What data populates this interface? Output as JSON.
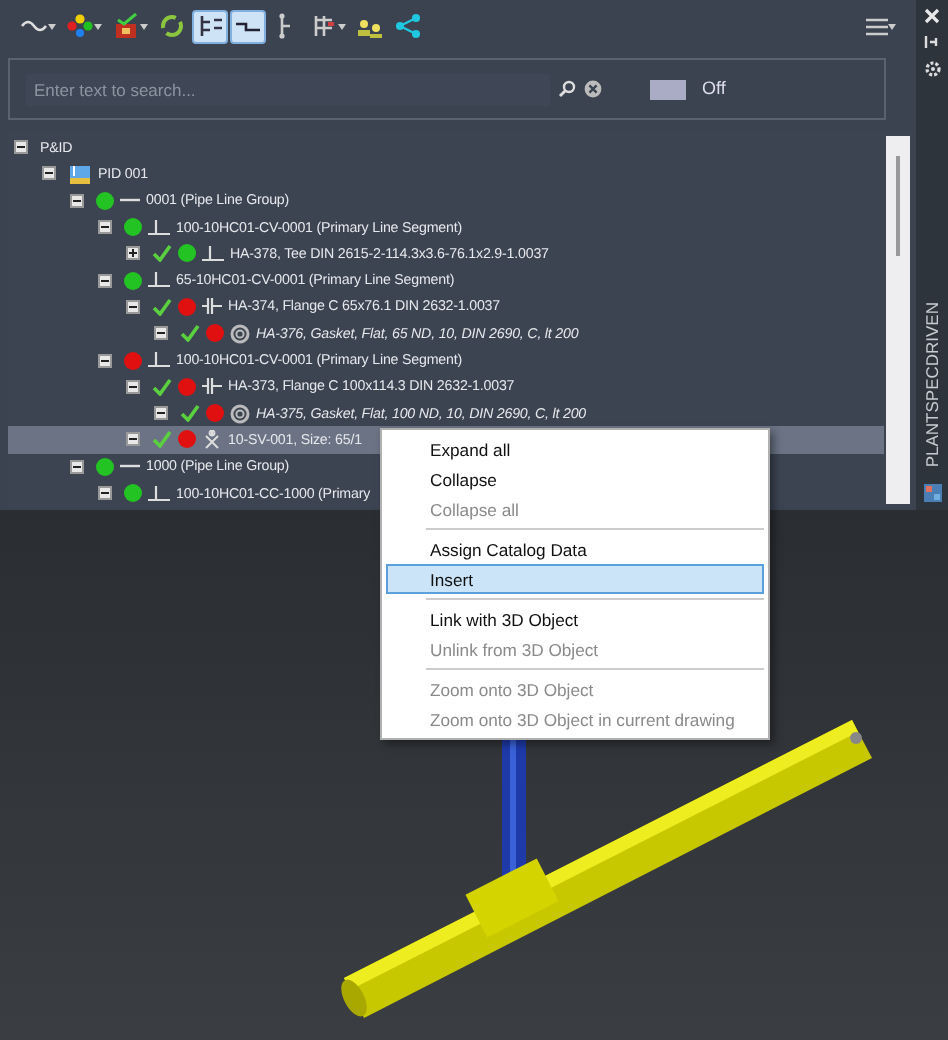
{
  "toolbar": {
    "buttons": [
      {
        "kind": "wave",
        "selected": false,
        "dropdown": true
      },
      {
        "kind": "nodes",
        "selected": false,
        "dropdown": true
      },
      {
        "kind": "lock",
        "selected": false,
        "dropdown": true
      },
      {
        "kind": "refresh",
        "selected": false,
        "dropdown": false
      },
      {
        "kind": "tree",
        "selected": true,
        "dropdown": false
      },
      {
        "kind": "line",
        "selected": true,
        "dropdown": false
      },
      {
        "kind": "branch",
        "selected": false,
        "dropdown": false
      },
      {
        "kind": "table",
        "selected": false,
        "dropdown": true
      },
      {
        "kind": "people",
        "selected": false,
        "dropdown": false
      },
      {
        "kind": "share",
        "selected": false,
        "dropdown": false
      }
    ],
    "menu": {
      "dropdown": true
    }
  },
  "search": {
    "placeholder": "Enter text to search...",
    "toggle": {
      "on": false,
      "label": "Off"
    }
  },
  "tree": [
    {
      "label": "P&ID",
      "expanded": true,
      "children": [
        {
          "label": "PID 001",
          "kind": "drawing",
          "expanded": true,
          "children": [
            {
              "label": "0001 (Pipe Line Group)",
              "kind": "group",
              "color": "#22c322",
              "expanded": true,
              "children": [
                {
                  "label": "100-10HC01-CV-0001 (Primary Line Segment)",
                  "kind": "segment",
                  "color": "#22c322",
                  "expanded": true,
                  "children": [
                    {
                      "label": "HA-378, Tee DIN 2615-2-114.3x3.6-76.1x2.9-1.0037",
                      "kind": "tee",
                      "color": "#22c322",
                      "checked": true,
                      "expanded": false,
                      "selected": false
                    }
                  ]
                },
                {
                  "label": "65-10HC01-CV-0001 (Primary Line Segment)",
                  "kind": "segment",
                  "color": "#22c322",
                  "expanded": true,
                  "children": [
                    {
                      "label": "HA-374, Flange C 65x76.1 DIN 2632-1.0037",
                      "kind": "flange",
                      "color": "#e01010",
                      "checked": true,
                      "expanded": true,
                      "selected": false,
                      "children": [
                        {
                          "label": "HA-376, Gasket, Flat, 65 ND, 10, DIN 2690, C, lt 200",
                          "kind": "gasket",
                          "color": "#e01010",
                          "checked": true,
                          "expanded": true,
                          "selected": false
                        }
                      ]
                    }
                  ]
                },
                {
                  "label": "100-10HC01-CV-0001 (Primary Line Segment)",
                  "kind": "segment",
                  "color": "#e01010",
                  "expanded": true,
                  "children": [
                    {
                      "label": "HA-373, Flange C 100x114.3 DIN 2632-1.0037",
                      "kind": "flange",
                      "color": "#e01010",
                      "checked": true,
                      "expanded": true,
                      "selected": false,
                      "children": [
                        {
                          "label": "HA-375, Gasket, Flat, 100 ND, 10, DIN 2690, C, lt 200",
                          "kind": "gasket",
                          "color": "#e01010",
                          "checked": true,
                          "expanded": true,
                          "selected": false
                        }
                      ]
                    },
                    {
                      "label": "10-SV-001, Size: 65/1",
                      "kind": "valve",
                      "color": "#e01010",
                      "checked": true,
                      "expanded": true,
                      "selected": true
                    }
                  ]
                }
              ]
            },
            {
              "label": "1000 (Pipe Line Group)",
              "kind": "group",
              "color": "#22c322",
              "expanded": true,
              "children": [
                {
                  "label": "100-10HC01-CC-1000 (Primary",
                  "kind": "segment",
                  "color": "#22c322",
                  "expanded": true
                }
              ]
            }
          ]
        }
      ]
    }
  ],
  "side_strip": {
    "title": "PLANTSPECDRIVEN"
  },
  "context_menu": {
    "groups": [
      [
        {
          "label": "Expand all",
          "disabled": false,
          "selected": false
        },
        {
          "label": "Collapse",
          "disabled": false,
          "selected": false
        },
        {
          "label": "Collapse all",
          "disabled": true,
          "selected": false
        }
      ],
      [
        {
          "label": "Assign Catalog Data",
          "disabled": false,
          "selected": false
        },
        {
          "label": "Insert",
          "disabled": false,
          "selected": true
        }
      ],
      [
        {
          "label": "Link with 3D Object",
          "disabled": false,
          "selected": false
        },
        {
          "label": "Unlink from 3D Object",
          "disabled": true,
          "selected": false
        }
      ],
      [
        {
          "label": "Zoom onto 3D Object",
          "disabled": true,
          "selected": false
        },
        {
          "label": "Zoom onto 3D Object in current drawing",
          "disabled": true,
          "selected": false
        }
      ]
    ]
  }
}
